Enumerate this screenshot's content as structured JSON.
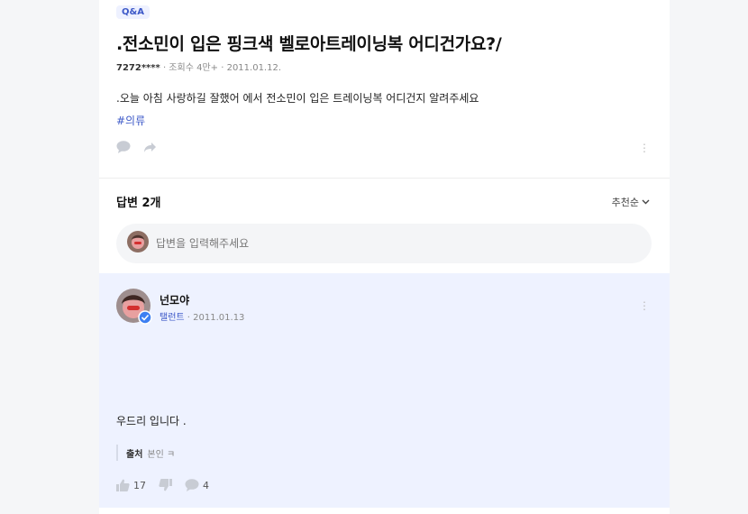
{
  "question": {
    "tag": "Q&A",
    "title": ".전소민이 입은 핑크색 벨로아트레이닝복 어디건가요?/",
    "author_id": "7272****",
    "views": "조회수 4만+",
    "date": "2011.01.12.",
    "body": ".오늘 아침 사랑하길 잘했어 에서 전소민이 입은 트레이닝복 어디건지 알려주세요",
    "hashtag": "#의류"
  },
  "answers_section": {
    "title": "답변 2개",
    "sort_label": "추천순",
    "input_placeholder": "답변을 입력해주세요"
  },
  "answer": {
    "author": "넌모야",
    "role": "탤런트",
    "date": "2011.01.13",
    "text": "우드리 입니다 .",
    "source_label": "출처",
    "source_value": "본인 ㅋ",
    "likes": "17",
    "comments": "4"
  },
  "colors": {
    "accent": "#3d59c8",
    "answer_bg": "#eef2ff",
    "page_bg": "#f5f6f8"
  }
}
